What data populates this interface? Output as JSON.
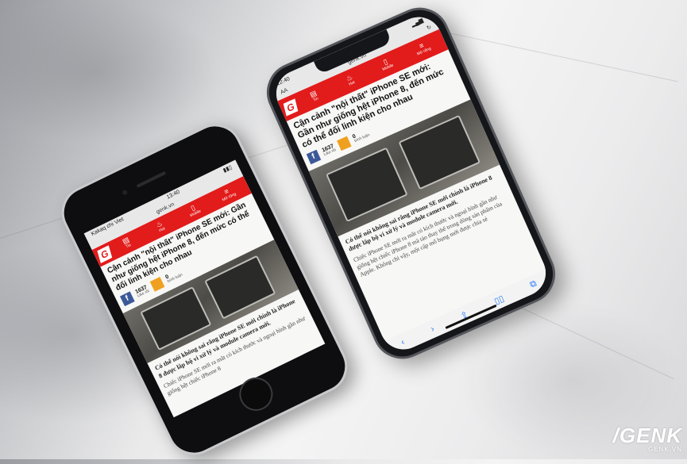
{
  "watermark": {
    "brand": "/GENK",
    "domain": "GENK.VN"
  },
  "phone_small": {
    "status_left": "Kakaq chi Viet",
    "time": "13:40",
    "url": "genk.vn",
    "nav": [
      {
        "label": "Tin",
        "icon": "document-icon"
      },
      {
        "label": "Hot",
        "icon": "fire-icon"
      },
      {
        "label": "Mobile",
        "icon": "phone-icon"
      },
      {
        "label": "Mở rộng",
        "icon": "menu-icon"
      }
    ],
    "headline": "Cận cảnh \"nội thất\" iPhone SE mới: Gần như giống hệt iPhone 8, đến mức có thể đổi linh kiện cho nhau",
    "likes": "1637",
    "likes_sub": "Like rồi",
    "comments": "0",
    "comments_sub": "bình luận",
    "caption": "Có thể nói không sai rằng iPhone SE mới chính là iPhone 8 được lắp bộ vi xử lý và module camera mới.",
    "body": "Chiếc iPhone SE mới ra mắt có kích thước và ngoại hình gần như giống hệt chiếc iPhone 8"
  },
  "phone_large": {
    "time": "12:40",
    "aa": "AA",
    "url": "genk.vn",
    "nav": [
      {
        "label": "Tin",
        "icon": "document-icon"
      },
      {
        "label": "Hot",
        "icon": "fire-icon"
      },
      {
        "label": "Mobile",
        "icon": "phone-icon"
      },
      {
        "label": "Mở rộng",
        "icon": "menu-icon"
      }
    ],
    "headline": "Cận cảnh \"nội thất\" iPhone SE mới: Gần như giống hệt iPhone 8, đến mức có thể đổi linh kiện cho nhau",
    "likes": "1637",
    "likes_sub": "Like rồi",
    "comments": "0",
    "comments_sub": "bình luận",
    "caption": "Có thể nói không sai rằng iPhone SE mới chính là iPhone 8 được lắp bộ vi xử lý và module camera mới.",
    "body": "Chiếc iPhone SE mới ra mắt có kích thước và ngoại hình gần như giống hệt chiếc iPhone 8 mà táo thay thế trong dòng sản phẩm của Apple. Không chỉ vậy, một cấp mổ bụng mới được chia sẻ"
  }
}
